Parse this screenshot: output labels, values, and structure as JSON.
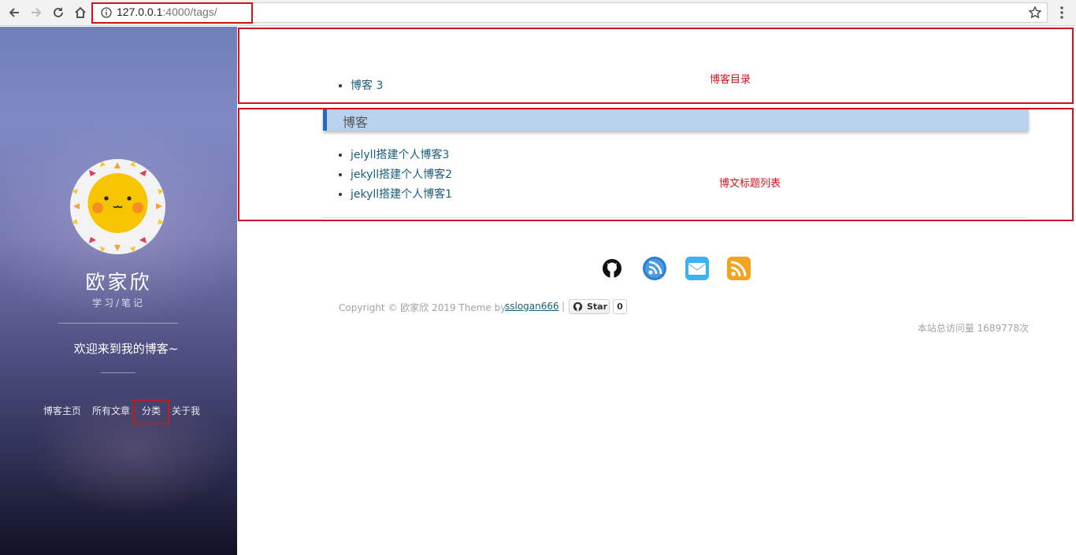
{
  "browser": {
    "url_host": "127.0.0.1",
    "url_rest": ":4000/tags/"
  },
  "sidebar": {
    "author": "欧家欣",
    "subtitle": "学习/笔记",
    "welcome": "欢迎来到我的博客~",
    "nav": [
      "博客主页",
      "所有文章",
      "分类",
      "关于我"
    ]
  },
  "main": {
    "tag_list": [
      {
        "label": "博客 3"
      }
    ],
    "annotation_top": "博客目录",
    "category_title": "博客",
    "posts": [
      {
        "title": "jelyll搭建个人博客3"
      },
      {
        "title": "jekyll搭建个人博客2"
      },
      {
        "title": "jekyll搭建个人博客1"
      }
    ],
    "annotation_posts": "博文标题列表"
  },
  "footer": {
    "social_icons": [
      "github-icon",
      "weibo-icon",
      "mail-icon",
      "rss-icon"
    ],
    "copyright": "Copyright © 欧家欣 2019 Theme by",
    "theme_author": "sslogan666",
    "separator": "|",
    "star_label": "Star",
    "star_count": "0",
    "visits": "本站总访问量 1689778次"
  },
  "colors": {
    "accent_red": "#d0141b",
    "link": "#1a5d7a",
    "category_bar": "#b9d3ee",
    "category_bar_edge": "#1e6fc2"
  }
}
